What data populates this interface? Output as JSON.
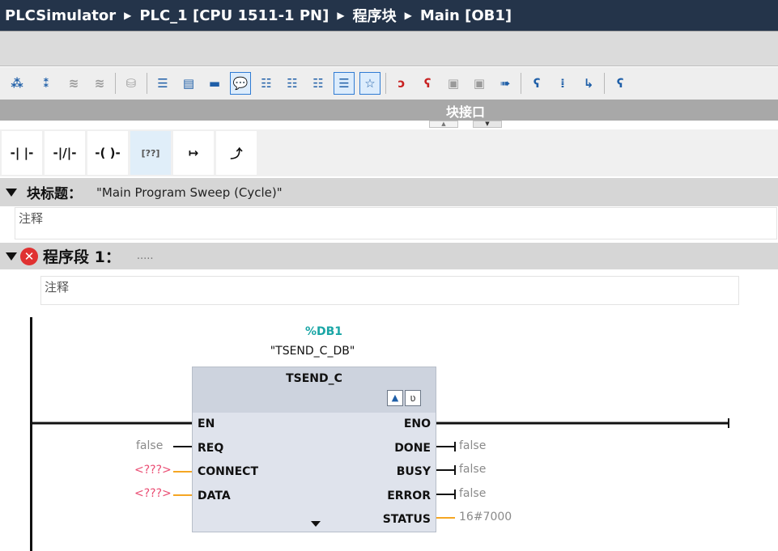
{
  "titlebar": {
    "app": "PLCSimulator",
    "plc": "PLC_1 [CPU 1511-1 PN]",
    "section": "程序块",
    "block": "Main [OB1]"
  },
  "toolbar": {
    "icons": [
      "insert-network-icon",
      "delete-network-icon",
      "insert-row-icon",
      "insert-row-grey-icon",
      "db-icon",
      "align-left-icon",
      "toggle-absolute-icon",
      "toggle-symbol-icon",
      "comment-icon",
      "network-list-icon",
      "favorites-icon",
      "monitor-icon",
      "call-icon",
      "error-icon",
      "access-icon",
      "download-icon",
      "compile-icon",
      "go-to-icon",
      "step-icon",
      "format-icon",
      "run-icon"
    ]
  },
  "interface": {
    "label": "块接口"
  },
  "instructions": {
    "items": [
      "-| |-",
      "-|/|-",
      "-( )-",
      "[??]",
      "↦",
      "⤴"
    ]
  },
  "block_title": {
    "label": "块标题：",
    "value": "\"Main Program Sweep (Cycle)\"",
    "comment": "注释"
  },
  "network": {
    "label": "程序段 1：",
    "dots": ".....",
    "comment": "注释"
  },
  "fb": {
    "address": "%DB1",
    "instance": "\"TSEND_C_DB\"",
    "type": "TSEND_C",
    "inputs": [
      "EN",
      "REQ",
      "CONNECT",
      "DATA"
    ],
    "outputs": [
      "ENO",
      "DONE",
      "BUSY",
      "ERROR",
      "STATUS"
    ],
    "input_values": {
      "req": "false",
      "connect": "<???>",
      "data": "<???>"
    },
    "output_values": {
      "done": "false",
      "busy": "false",
      "error": "false",
      "status": "16#7000"
    }
  },
  "colors": {
    "titlebar": "#24344a",
    "wire_active": "#111111",
    "wire_pending": "#f5a623",
    "placeholder_red": "#ea4c72",
    "address_teal": "#1aa6a6"
  }
}
